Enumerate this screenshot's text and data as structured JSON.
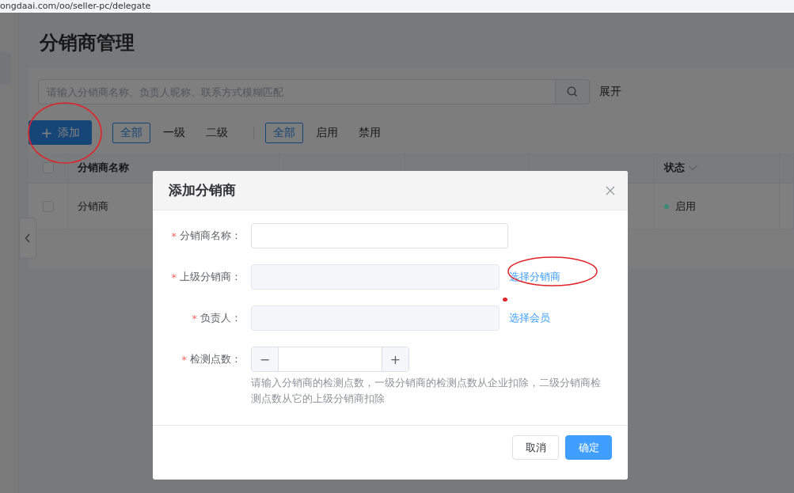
{
  "address_bar": {
    "url": "ongdaai.com/oo/seller-pc/delegate"
  },
  "page": {
    "title": "分销商管理",
    "search": {
      "placeholder": "请输入分销商名称、负责人昵称、联系方式模糊匹配",
      "expand_label": "展开"
    },
    "add_button": {
      "icon": "+",
      "label": "添加"
    },
    "level_filters": [
      {
        "label": "全部",
        "selected": true
      },
      {
        "label": "一级",
        "selected": false
      },
      {
        "label": "二级",
        "selected": false
      }
    ],
    "status_filters": [
      {
        "label": "全部",
        "selected": true
      },
      {
        "label": "启用",
        "selected": false
      },
      {
        "label": "禁用",
        "selected": false
      }
    ],
    "table": {
      "select_all_checked": false,
      "columns": [
        "分销商名称",
        "状态"
      ],
      "rows": [
        {
          "checked": false,
          "name": "分销商",
          "status": "启用",
          "color": "#3a8a76"
        }
      ]
    }
  },
  "dialog": {
    "title": "添加分销商",
    "fields": [
      {
        "kind": "input",
        "label": "分销商名称：",
        "required_mark": "*"
      },
      {
        "kind": "picker",
        "label": "上级分销商：",
        "required_mark": "*",
        "action": "选择分销商"
      },
      {
        "kind": "picker",
        "label": "负责人：",
        "required_mark": "*",
        "action": "选择会员"
      },
      {
        "kind": "stepper",
        "label": "检测点数：",
        "required_mark": "*",
        "minus": "−",
        "plus": "+",
        "hint": "请输入分销商的检测点数，一级分销商的检测点数从企业扣除，二级分销商检测点数从它的上级分销商扣除"
      }
    ],
    "buttons": [
      {
        "label": "取消",
        "kind": "default"
      },
      {
        "label": "确定",
        "kind": "primary"
      }
    ]
  }
}
